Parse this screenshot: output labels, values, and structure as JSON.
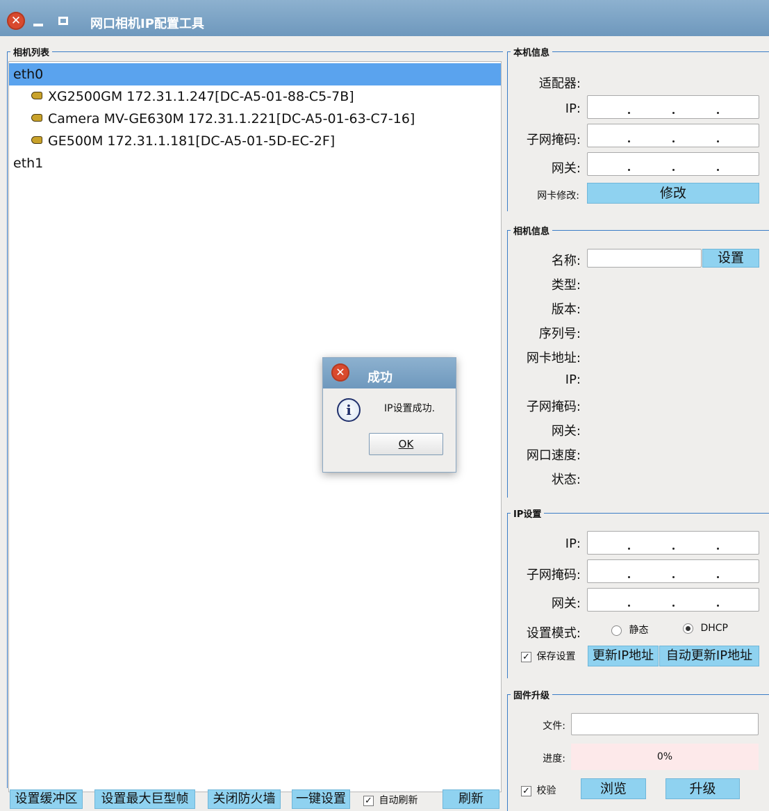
{
  "window": {
    "title": "网口相机IP配置工具"
  },
  "camera_list": {
    "title": "相机列表",
    "items": [
      {
        "label": "eth0",
        "selected": true
      },
      {
        "label": "XG2500GM 172.31.1.247[DC-A5-01-88-C5-7B]",
        "icon": "camera-icon"
      },
      {
        "label": "Camera MV-GE630M 172.31.1.221[DC-A5-01-63-C7-16]",
        "icon": "camera-icon"
      },
      {
        "label": "GE500M 172.31.1.181[DC-A5-01-5D-EC-2F]",
        "icon": "camera-icon"
      },
      {
        "label": "eth1"
      }
    ]
  },
  "local_info": {
    "title": "本机信息",
    "adapter_label": "适配器:",
    "ip_label": "IP:",
    "mask_label": "子网掩码:",
    "gateway_label": "网关:",
    "nic_modify_label": "网卡修改:",
    "modify_button": "修改"
  },
  "camera_info": {
    "title": "相机信息",
    "name_label": "名称:",
    "set_button": "设置",
    "type_label": "类型:",
    "version_label": "版本:",
    "serial_label": "序列号:",
    "mac_label": "网卡地址:",
    "ip_label": "IP:",
    "mask_label": "子网掩码:",
    "gateway_label": "网关:",
    "speed_label": "网口速度:",
    "status_label": "状态:"
  },
  "ip_settings": {
    "title": "IP设置",
    "ip_label": "IP:",
    "mask_label": "子网掩码:",
    "gateway_label": "网关:",
    "mode_label": "设置模式:",
    "static_label": "静态",
    "dhcp_label": "DHCP",
    "mode_selected": "DHCP",
    "save_label": "保存设置",
    "save_checked": true,
    "update_ip_button": "更新IP地址",
    "auto_update_ip_button": "自动更新IP地址"
  },
  "firmware": {
    "title": "固件升级",
    "file_label": "文件:",
    "progress_label": "进度:",
    "progress_text": "0%",
    "progress_value": 0,
    "verify_label": "校验",
    "verify_checked": true,
    "browse_button": "浏览",
    "upgrade_button": "升级"
  },
  "bottom_bar": {
    "buffer_button": "设置缓冲区",
    "jumbo_button": "设置最大巨型帧",
    "firewall_button": "关闭防火墙",
    "one_key_button": "一键设置",
    "auto_refresh_label": "自动刷新",
    "auto_refresh_checked": true,
    "refresh_button": "刷新"
  },
  "dialog": {
    "title": "成功",
    "message": "IP设置成功.",
    "ok_button": "OK"
  },
  "colors": {
    "title_bar": "#7ba3c7",
    "selection": "#5aa3ee",
    "button_blue": "#8fd2f0",
    "group_line": "#3a7cc7",
    "progress_bg": "#fde9ea"
  }
}
